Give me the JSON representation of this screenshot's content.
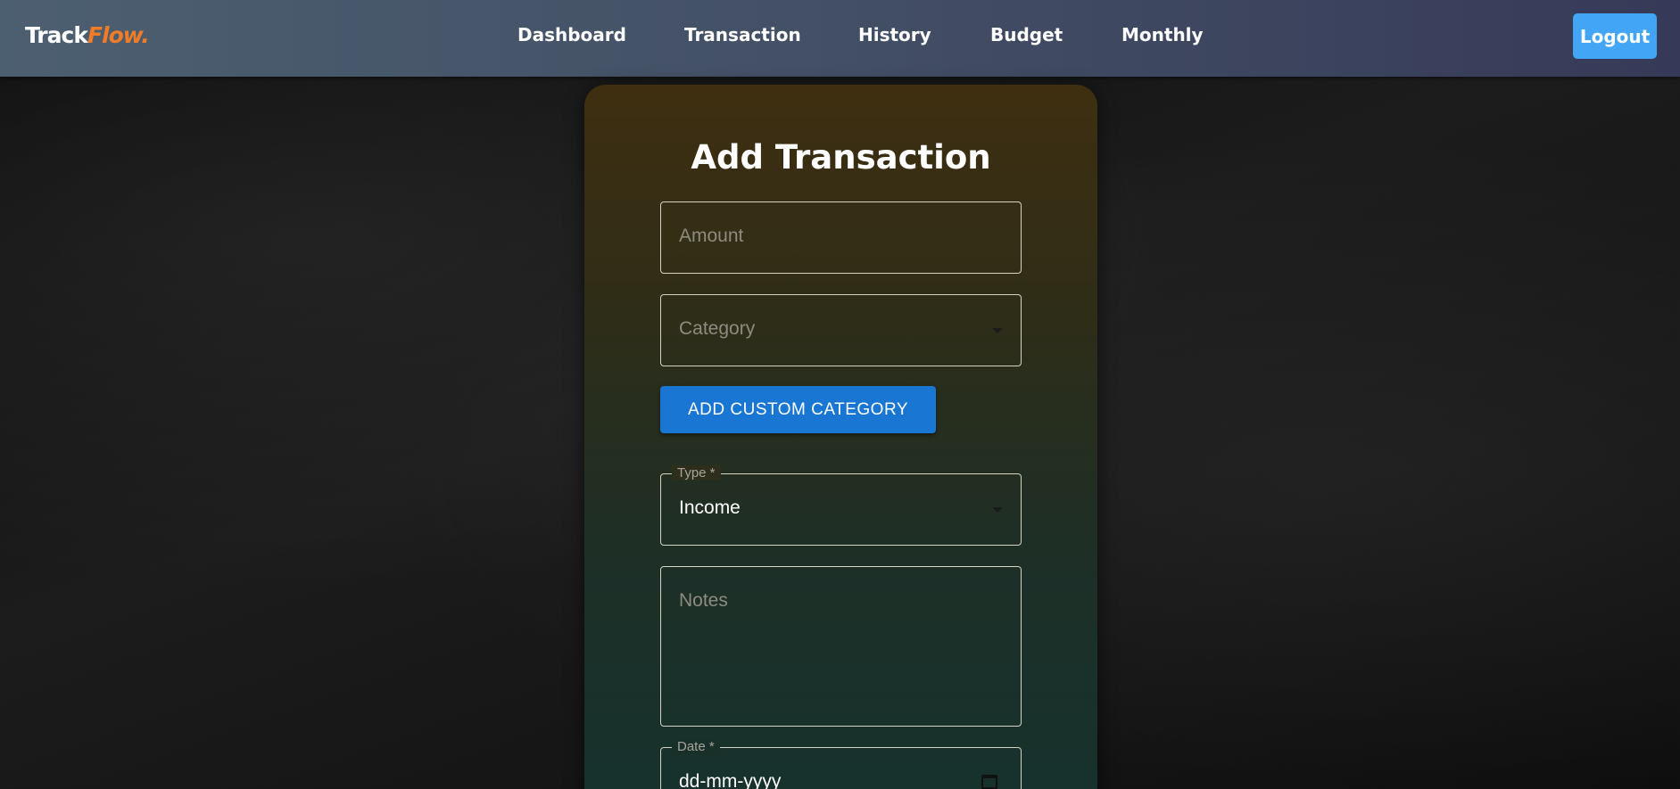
{
  "navbar": {
    "logo_main": "Track",
    "logo_accent": "Flow.",
    "links": [
      "Dashboard",
      "Transaction",
      "History",
      "Budget",
      "Monthly"
    ],
    "logout_label": "Logout"
  },
  "form": {
    "title": "Add Transaction",
    "amount": {
      "placeholder": "Amount"
    },
    "category": {
      "placeholder": "Category"
    },
    "add_custom_category_label": "ADD CUSTOM CATEGORY",
    "type": {
      "label": "Type *",
      "value": "Income"
    },
    "notes": {
      "placeholder": "Notes"
    },
    "date": {
      "label": "Date *",
      "placeholder": "dd-mm-yyyy"
    }
  },
  "colors": {
    "logo_accent": "#f07c28",
    "logout_button": "#42a5f5",
    "primary_button": "#1976d2"
  },
  "icons": {
    "select_caret": "chevron-down-icon",
    "date_picker": "calendar-icon"
  }
}
